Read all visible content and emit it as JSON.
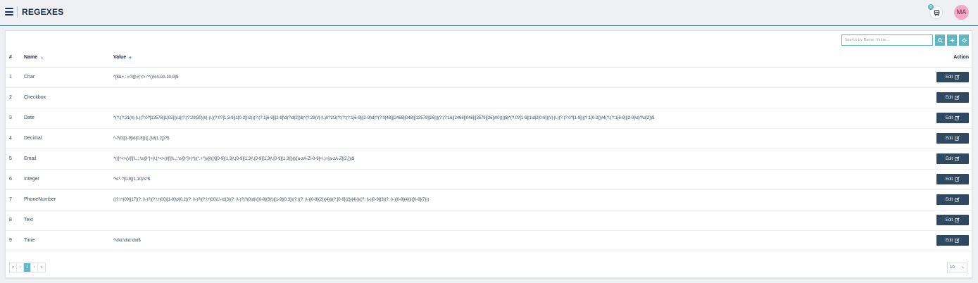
{
  "header": {
    "title": "REGEXES",
    "notification_count": "0",
    "avatar_initials": "MA"
  },
  "toolbar": {
    "search_placeholder": "Search by Name, Value..."
  },
  "table": {
    "columns": {
      "num": "#",
      "name": "Name",
      "value": "Value",
      "action": "Action"
    },
    "edit_label": "Edit",
    "rows": [
      {
        "num": "1",
        "name": "Char",
        "value": "^[$&+,:;=?@#|'<>.^*()%!\\-0A-z0-9]$"
      },
      {
        "num": "2",
        "name": "Checkbox",
        "value": ""
      },
      {
        "num": "3",
        "name": "Date",
        "value": "^(?:(?:31(\\/|-|\\.)(?:0?[13578]|1[02]))\\1|(?:(?:29|30)(\\/|-|\\.)(?:0?[1,3-9]|1[0-2])\\2))(?:(?:1[6-9]|[2-9]\\d)?\\d{2})$|^(?:29(\\/|-|\\.)0?2\\3(?:(?:(?:1[6-9]|[2-9]\\d)?(?:0[48]|[2468][048]|[13579][26])|(?:(?:16|[2468][048]|[3579][26])00))))$|^(?:0?[1-9]|1\\d|2[0-8])(\\/|-|\\.)(?:(?:0?[1-9])|(?:1[0-2]))\\4(?:(?:1[6-9]|[2-9]\\d)?\\d{2})$"
      },
      {
        "num": "4",
        "name": "Decimal",
        "value": "^-?(0|[1-9]\\d{0,8})([.,]\\d{1,2})?$"
      },
      {
        "num": "5",
        "name": "Email",
        "value": "^(([^<>()\\[\\]\\\\.,;:\\s@\"]+(\\.[^<>()\\[\\]\\\\.,;:\\s@\"]+)*)|(\".+\"))@((\\[[0-9]{1,3}\\.[0-9]{1,3}\\.[0-9]{1,3}\\.[0-9]{1,3}])|(([a-zA-Z\\-0-9]+\\.)+[a-zA-Z]{2,}))$"
      },
      {
        "num": "6",
        "name": "Integer",
        "value": "^\\s*-?[0-9]{1,10}\\s*$"
      },
      {
        "num": "7",
        "name": "PhoneNumber",
        "value": "((?:\\+|00)[17](?: |\\-)?|(?:\\+|00)[1-9]\\d{0,2}(?: |\\-)?|(?:\\+|00)1\\-\\d{3}(?: |\\-)?)?(0\\d|\\([0-9]{3}\\)|[1-9]{0,3})(?:((?: |\\-)[0-9]{2}){4}|((?:[0-9]{2}){4})|((?: |\\-)[0-9]{3}(?: |\\-)[0-9]{4})|([0-9]{7}))"
      },
      {
        "num": "8",
        "name": "Text",
        "value": ""
      },
      {
        "num": "9",
        "name": "Time",
        "value": "^\\d\\d:\\d\\d:\\d\\d$"
      }
    ]
  },
  "pagination": {
    "first": "«",
    "prev": "‹",
    "current": "1",
    "next": "›",
    "last": "»",
    "page_size": "10"
  },
  "colors": {
    "accent": "#5fb7c4",
    "edit_button": "#2f4a60",
    "title": "#1b2e45",
    "avatar": "#f4a6c9"
  },
  "icons": {
    "menu": "hamburger-icon",
    "notifications": "notification-icon",
    "search": "search-icon",
    "add": "plus-icon",
    "settings": "gear-icon",
    "edit": "edit-icon",
    "sort": "sort-icon"
  }
}
